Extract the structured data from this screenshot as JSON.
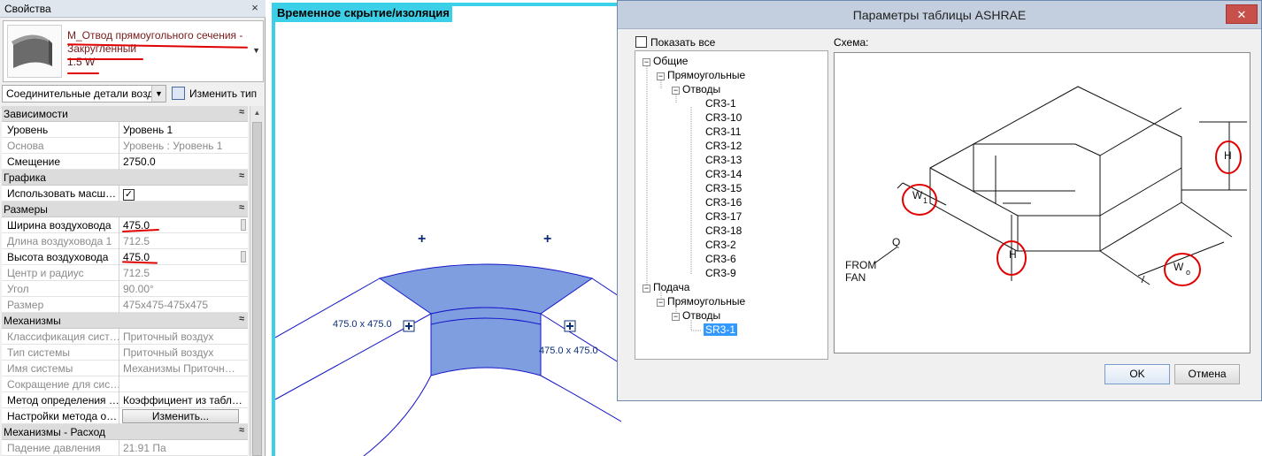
{
  "properties_panel": {
    "title": "Свойства",
    "close_glyph": "×",
    "type_name": "M_Отвод прямоугольного сечения - Закругленный",
    "type_size": "1.5 W",
    "filter_value": "Соединительные детали возд",
    "edit_type_label": "Изменить тип",
    "groups": {
      "constraints": "Зависимости",
      "graphics": "Графика",
      "dimensions": "Размеры",
      "mechanical": "Механизмы",
      "mechanical_flow": "Механизмы - Расход"
    },
    "rows": {
      "level": {
        "label": "Уровень",
        "value": "Уровень 1"
      },
      "host": {
        "label": "Основа",
        "value": "Уровень : Уровень 1"
      },
      "offset": {
        "label": "Смещение",
        "value": "2750.0"
      },
      "use_scale": {
        "label": "Использовать масш…",
        "value": "✓"
      },
      "duct_width": {
        "label": "Ширина воздуховода",
        "value": "475.0"
      },
      "duct_length": {
        "label": "Длина воздуховода 1",
        "value": "712.5"
      },
      "duct_height": {
        "label": "Высота воздуховода",
        "value": "475.0"
      },
      "center_radius": {
        "label": "Центр и радиус",
        "value": "712.5"
      },
      "angle": {
        "label": "Угол",
        "value": "90.00°"
      },
      "size": {
        "label": "Размер",
        "value": "475x475-475x475"
      },
      "system_class": {
        "label": "Классификация сист…",
        "value": "Приточный воздух"
      },
      "system_type": {
        "label": "Тип системы",
        "value": "Приточный воздух"
      },
      "system_name": {
        "label": "Имя системы",
        "value": "Механизмы Приточн…"
      },
      "system_abbr": {
        "label": "Сокращение для сис…",
        "value": ""
      },
      "loss_method": {
        "label": "Метод определения …",
        "value": "Коэффициент из табл…"
      },
      "loss_settings": {
        "label": "Настройки метода о…",
        "value": "Изменить..."
      },
      "pressure_drop": {
        "label": "Падение давления",
        "value": "21.91 Па"
      }
    },
    "collapse_glyph": "≈"
  },
  "canvas": {
    "mode_label": "Временное скрытие/изоляция",
    "dim_left": "475.0 x 475.0",
    "dim_right": "475.0 x 475.0",
    "plus_glyph": "+"
  },
  "dialog": {
    "title": "Параметры таблицы ASHRAE",
    "close_glyph": "✕",
    "show_all_label": "Показать все",
    "schema_label": "Схема:",
    "tree": {
      "general": "Общие",
      "general_rect": "Прямоугольные",
      "general_elbows": "Отводы",
      "items": [
        "CR3-1",
        "CR3-10",
        "CR3-11",
        "CR3-12",
        "CR3-13",
        "CR3-14",
        "CR3-15",
        "CR3-16",
        "CR3-17",
        "CR3-18",
        "CR3-2",
        "CR3-6",
        "CR3-9"
      ],
      "supply": "Подача",
      "supply_rect": "Прямоугольные",
      "supply_elbows": "Отводы",
      "supply_item": "SR3-1"
    },
    "schema_text": {
      "from_fan_1": "FROM",
      "from_fan_2": "FAN",
      "flow": "Q",
      "w1": "W",
      "w1_sub": "1",
      "h_left": "H",
      "h_right": "H",
      "wo": "W",
      "wo_sub": "o"
    },
    "ok_label": "OK",
    "cancel_label": "Отмена"
  },
  "colors": {
    "cyan_accent": "#3cd0e8",
    "elbow_fill": "#7e9ee0",
    "model_line": "#1515c8",
    "annotation_red": "#e00000",
    "selection_blue": "#3399ff"
  }
}
